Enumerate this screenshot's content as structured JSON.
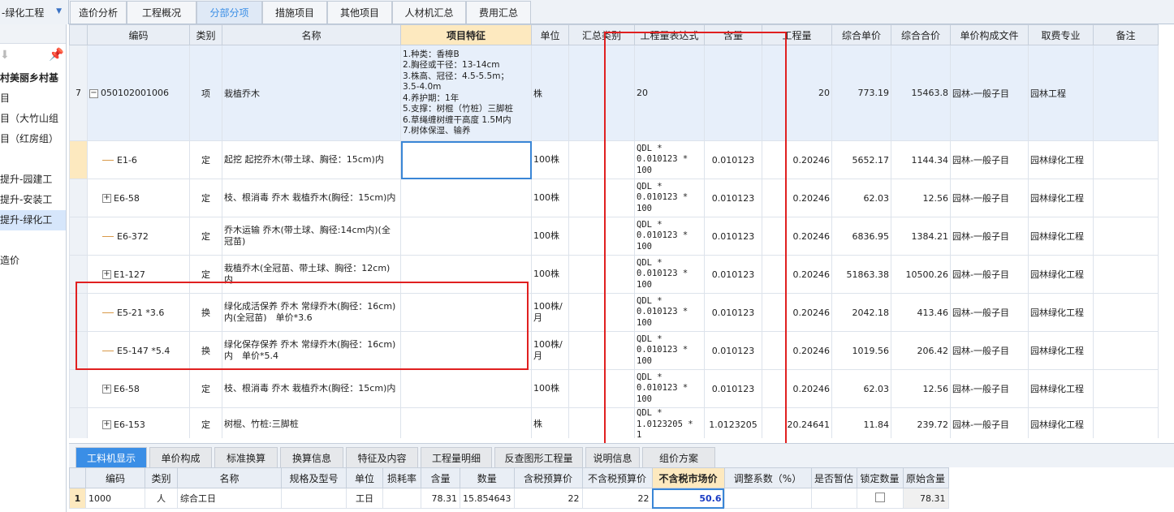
{
  "project_select": {
    "label": "-绿化工程",
    "arrow_icon": "dropdown-triangle"
  },
  "top_tabs": [
    "造价分析",
    "工程概况",
    "分部分项",
    "措施项目",
    "其他项目",
    "人材机汇总",
    "费用汇总"
  ],
  "left_panel": {
    "items": [
      "村美丽乡村基",
      "目",
      "目（大竹山组",
      "目（红房组）",
      "",
      "提升-园建工",
      "提升-安装工",
      "提升-绿化工",
      "",
      "造价"
    ]
  },
  "grid": {
    "headers": [
      "编码",
      "类别",
      "名称",
      "项目特征",
      "单位",
      "汇总类别",
      "工程量表达式",
      "含量",
      "工程量",
      "综合单价",
      "综合合价",
      "单价构成文件",
      "取费专业",
      "备注"
    ],
    "main_row": {
      "row_no": "7",
      "code": "050102001006",
      "type": "项",
      "name": "栽植乔木",
      "feature_lines": [
        "1.种类：香樟B",
        "2.胸径或干径：13-14cm",
        "3.株高、冠径：4.5-5.5m；",
        "3.5-4.0m",
        "4.养护期：1年",
        "5.支撑：树棍（竹桩）三脚桩",
        "6.草绳缠树缠干高度 1.5M内",
        "7.树体保湿、输养"
      ],
      "unit": "株",
      "expr": "20",
      "qty": "20",
      "unit_price": "773.19",
      "total": "15463.8",
      "price_file": "园林-一般子目",
      "fee_type": "园林工程"
    },
    "rows": [
      {
        "code": "E1-6",
        "expander": false,
        "type": "定",
        "name": "起挖 起挖乔木(带土球、胸径：15cm)内",
        "unit": "100株",
        "expr": "QDL * 0.010123 * 100",
        "content": "0.010123",
        "qty": "0.20246",
        "unit_price": "5652.17",
        "total": "1144.34",
        "price_file": "园林-一般子目",
        "fee_type": "园林绿化工程"
      },
      {
        "code": "E6-58",
        "expander": true,
        "type": "定",
        "name": "枝、根消毒 乔木 栽植乔木(胸径：15cm)内",
        "unit": "100株",
        "expr": "QDL * 0.010123 * 100",
        "content": "0.010123",
        "qty": "0.20246",
        "unit_price": "62.03",
        "total": "12.56",
        "price_file": "园林-一般子目",
        "fee_type": "园林绿化工程"
      },
      {
        "code": "E6-372",
        "expander": false,
        "type": "定",
        "name": "乔木运输 乔木(带土球、胸径:14cm内)(全冠苗)",
        "unit": "100株",
        "expr": "QDL * 0.010123 * 100",
        "content": "0.010123",
        "qty": "0.20246",
        "unit_price": "6836.95",
        "total": "1384.21",
        "price_file": "园林-一般子目",
        "fee_type": "园林绿化工程"
      },
      {
        "code": "E1-127",
        "expander": true,
        "type": "定",
        "name": "栽植乔木(全冠苗、带土球、胸径：12cm)内",
        "unit": "100株",
        "expr": "QDL * 0.010123 * 100",
        "content": "0.010123",
        "qty": "0.20246",
        "unit_price": "51863.38",
        "total": "10500.26",
        "price_file": "园林-一般子目",
        "fee_type": "园林绿化工程"
      },
      {
        "code": "E5-21 *3.6",
        "expander": false,
        "type": "换",
        "name": "绿化成活保养 乔木 常绿乔木(胸径：16cm)内(全冠苗)　单价*3.6",
        "unit": "100株/月",
        "expr": "QDL * 0.010123 * 100",
        "content": "0.010123",
        "qty": "0.20246",
        "unit_price": "2042.18",
        "total": "413.46",
        "price_file": "园林-一般子目",
        "fee_type": "园林绿化工程"
      },
      {
        "code": "E5-147 *5.4",
        "expander": false,
        "type": "换",
        "name": "绿化保存保养 乔木 常绿乔木(胸径：16cm)内　单价*5.4",
        "unit": "100株/月",
        "expr": "QDL * 0.010123 * 100",
        "content": "0.010123",
        "qty": "0.20246",
        "unit_price": "1019.56",
        "total": "206.42",
        "price_file": "园林-一般子目",
        "fee_type": "园林绿化工程"
      },
      {
        "code": "E6-58",
        "expander": true,
        "type": "定",
        "name": "枝、根消毒 乔木 栽植乔木(胸径：15cm)内",
        "unit": "100株",
        "expr": "QDL * 0.010123 * 100",
        "content": "0.010123",
        "qty": "0.20246",
        "unit_price": "62.03",
        "total": "12.56",
        "price_file": "园林-一般子目",
        "fee_type": "园林绿化工程"
      },
      {
        "code": "E6-153",
        "expander": true,
        "type": "定",
        "name": "树棍、竹桩:三脚桩",
        "unit": "株",
        "expr": "QDL * 1.0123205 * 1",
        "content": "1.0123205",
        "qty": "20.24641",
        "unit_price": "11.84",
        "total": "239.72",
        "price_file": "园林-一般子目",
        "fee_type": "园林绿化工程"
      }
    ]
  },
  "bottom_tabs": [
    "工料机显示",
    "单价构成",
    "标准换算",
    "换算信息",
    "特征及内容",
    "工程量明细",
    "反查图形工程量",
    "说明信息",
    "组价方案"
  ],
  "bottom_grid": {
    "headers": [
      "编码",
      "类别",
      "名称",
      "规格及型号",
      "单位",
      "损耗率",
      "含量",
      "数量",
      "含税预算价",
      "不含税预算价",
      "不含税市场价",
      "调整系数（%）",
      "是否暂估",
      "锁定数量",
      "原始含量"
    ],
    "rows": [
      {
        "row_no": "1",
        "code": "1000",
        "type": "人",
        "name": "综合工日",
        "spec": "",
        "unit": "工日",
        "loss": "",
        "content": "78.31",
        "qty": "15.854643",
        "tax_price": "22",
        "notax_price": "22",
        "market_price": "50.6",
        "adjust": "",
        "estimate": "",
        "locked": false,
        "orig": "78.31"
      }
    ]
  }
}
